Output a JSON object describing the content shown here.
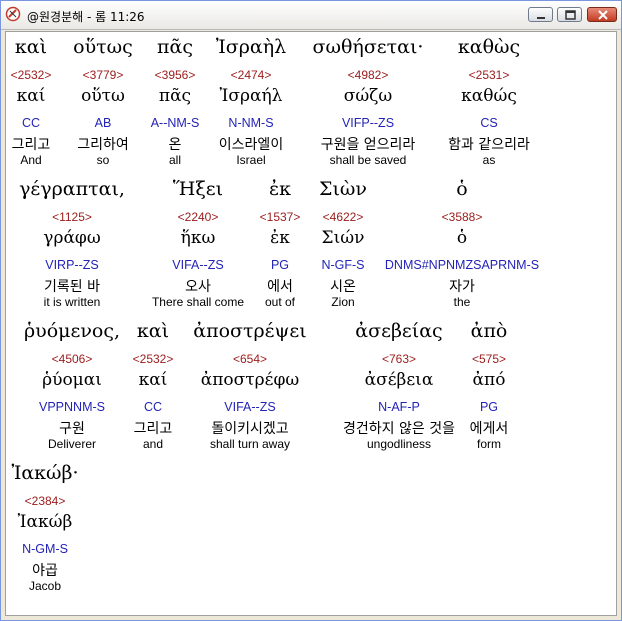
{
  "window": {
    "title": "@원경분해 - 롬 11:26"
  },
  "rows": [
    {
      "y": 0,
      "words": [
        {
          "greek": "καὶ",
          "number": "<2532>",
          "lemma": "καί",
          "morph": "CC",
          "korean": "그리고",
          "english": "And"
        },
        {
          "greek": "οὕτως",
          "number": "<3779>",
          "lemma": "οὕτω",
          "morph": "AB",
          "korean": "그리하여",
          "english": "so"
        },
        {
          "greek": "πᾶς",
          "number": "<3956>",
          "lemma": "πᾶς",
          "morph": "A--NM-S",
          "korean": "온",
          "english": "all"
        },
        {
          "greek": "Ἰσραὴλ",
          "number": "<2474>",
          "lemma": "Ἰσραήλ",
          "morph": "N-NM-S",
          "korean": "이스라엘이",
          "english": "Israel"
        },
        {
          "greek": "σωθήσεται·",
          "number": "<4982>",
          "lemma": "σώζω",
          "morph": "VIFP--ZS",
          "korean": "구원을 얻으리라",
          "english": "shall be saved"
        },
        {
          "greek": "καθὼς",
          "number": "<2531>",
          "lemma": "καθώς",
          "morph": "CS",
          "korean": "함과 같으리라",
          "english": "as"
        }
      ]
    },
    {
      "y": 1,
      "words": [
        {
          "greek": "γέγραπται,",
          "number": "<1125>",
          "lemma": "γράφω",
          "morph": "VIRP--ZS",
          "korean": "기록된 바",
          "english": "it is written"
        },
        {
          "greek": "Ἥξει",
          "number": "<2240>",
          "lemma": "ἥκω",
          "morph": "VIFA--ZS",
          "korean": "오사",
          "english": "There shall come"
        },
        {
          "greek": "ἐκ",
          "number": "<1537>",
          "lemma": "ἐκ",
          "morph": "PG",
          "korean": "에서",
          "english": "out of"
        },
        {
          "greek": "Σιὼν",
          "number": "<4622>",
          "lemma": "Σιών",
          "morph": "N-GF-S",
          "korean": "시온",
          "english": "Zion"
        },
        {
          "greek": "ὁ",
          "number": "<3588>",
          "lemma": "ὁ",
          "morph": "DNMS#NPNMZSAPRNM-S",
          "korean": "자가",
          "english": "the"
        }
      ]
    },
    {
      "y": 2,
      "words": [
        {
          "greek": "ῥυόμενος,",
          "number": "<4506>",
          "lemma": "ῥύομαι",
          "morph": "VPPNNM-S",
          "korean": "구원",
          "english": "Deliverer"
        },
        {
          "greek": "καὶ",
          "number": "<2532>",
          "lemma": "καί",
          "morph": "CC",
          "korean": "그리고",
          "english": "and"
        },
        {
          "greek": "ἀποστρέψει",
          "number": "<654>",
          "lemma": "ἀποστρέφω",
          "morph": "VIFA--ZS",
          "korean": "돌이키시겠고",
          "english": "shall turn away"
        },
        {
          "greek": "ἀσεβείας",
          "number": "<763>",
          "lemma": "ἀσέβεια",
          "morph": "N-AF-P",
          "korean": "경건하지 않은 것을",
          "english": "ungodliness"
        },
        {
          "greek": "ἀπὸ",
          "number": "<575>",
          "lemma": "ἀπό",
          "morph": "PG",
          "korean": "에게서",
          "english": "form"
        }
      ]
    },
    {
      "y": 3,
      "words": [
        {
          "greek": "Ἰακώβ·",
          "number": "<2384>",
          "lemma": "Ἰακώβ",
          "morph": "N-GM-S",
          "korean": "야곱",
          "english": "Jacob"
        }
      ]
    }
  ]
}
